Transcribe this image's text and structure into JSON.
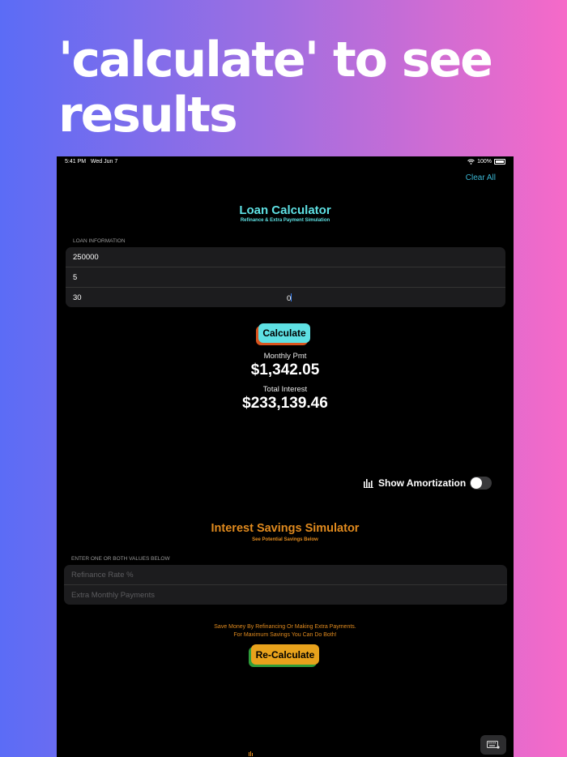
{
  "headline": "'calculate' to see results",
  "status": {
    "time": "5:41 PM",
    "date": "Wed Jun 7",
    "battery": "100%"
  },
  "toolbar": {
    "clear_all": "Clear All"
  },
  "loan": {
    "title": "Loan Calculator",
    "subtitle": "Refinance & Extra Payment Simulation",
    "section_label": "LOAN INFORMATION",
    "fields": [
      "250000",
      "5",
      "30"
    ],
    "focused_value": "0",
    "calculate_label": "Calculate",
    "monthly_label": "Monthly Pmt",
    "monthly_value": "$1,342.05",
    "interest_label": "Total Interest",
    "interest_value": "$233,139.46"
  },
  "amortization": {
    "label": "Show Amortization",
    "enabled": false
  },
  "simulator": {
    "title": "Interest Savings Simulator",
    "subtitle": "See Potential Savings Below",
    "section_label": "ENTER ONE OR BOTH VALUES BELOW",
    "refinance_placeholder": "Refinance Rate %",
    "extra_placeholder": "Extra Monthly Payments",
    "note_line1": "Save Money By Refinancing Or Making Extra Payments.",
    "note_line2": "For Maximum Savings You Can Do Both!",
    "recalculate_label": "Re-Calculate"
  },
  "colors": {
    "cyan": "#5ee0e3",
    "orange": "#e08a1e",
    "link": "#3bb7d4"
  },
  "icons": [
    "wifi-icon",
    "battery-icon",
    "chart-bars-icon",
    "keyboard-icon"
  ]
}
